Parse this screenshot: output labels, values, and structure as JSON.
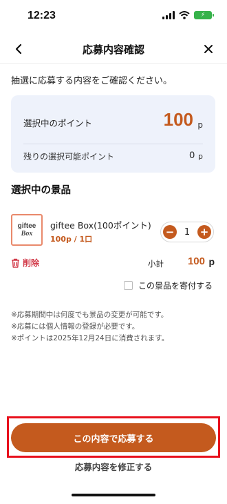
{
  "status_bar": {
    "time": "12:23"
  },
  "header": {
    "title": "応募内容確認"
  },
  "intro_text": "抽選に応募する内容をご確認ください。",
  "points_card": {
    "selected_label": "選択中のポイント",
    "selected_value": "100",
    "selected_unit": "p",
    "remaining_label": "残りの選択可能ポイント",
    "remaining_value": "0",
    "remaining_unit": "p"
  },
  "section_title": "選択中の景品",
  "prize": {
    "thumb_line1": "giftee",
    "thumb_line2": "Box",
    "name": "giftee Box(100ポイント)",
    "price": "100p / 1口",
    "quantity": "1",
    "minus": "−",
    "plus": "+"
  },
  "delete_label": "削除",
  "subtotal": {
    "label": "小計",
    "value": "100",
    "unit": "p"
  },
  "donate_label": "この景品を寄付する",
  "notes": [
    "※応募期間中は何度でも景品の変更が可能です。",
    "※応募には個人情報の登録が必要です。",
    "※ポイントは2025年12月24日に消費されます。"
  ],
  "actions": {
    "submit_label": "この内容で応募する",
    "modify_label": "応募内容を修正する"
  },
  "colors": {
    "accent": "#c45a1e",
    "delete": "#d23b4a",
    "highlight": "#e8101c",
    "card_bg": "#eef2fb"
  }
}
